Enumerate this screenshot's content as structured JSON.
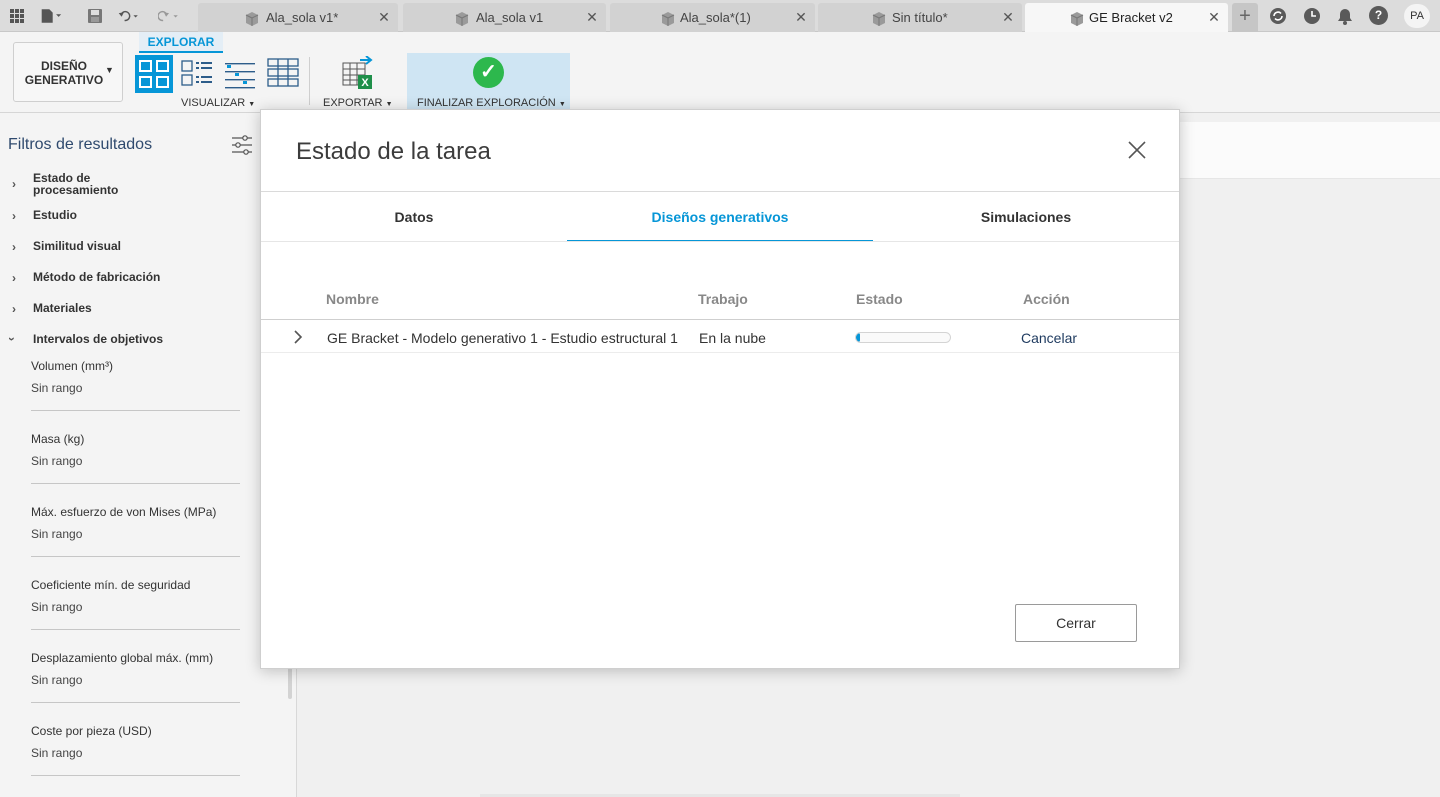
{
  "tabs": [
    {
      "label": "Ala_sola v1*",
      "active": false
    },
    {
      "label": "Ala_sola v1",
      "active": false
    },
    {
      "label": "Ala_sola*(1)",
      "active": false
    },
    {
      "label": "Sin título*",
      "active": false
    },
    {
      "label": "GE Bracket v2",
      "active": true
    }
  ],
  "user_initials": "PA",
  "toolbar": {
    "workspace_label": "DISEÑO GENERATIVO",
    "explore_tab": "EXPLORAR",
    "visualize_label": "VISUALIZAR",
    "export_label": "EXPORTAR",
    "finish_label": "FINALIZAR EXPLORACIÓN"
  },
  "sidebar": {
    "title": "Filtros de resultados",
    "categories": [
      {
        "label": "Estado de procesamiento",
        "expanded": false
      },
      {
        "label": "Estudio",
        "expanded": false
      },
      {
        "label": "Similitud visual",
        "expanded": false
      },
      {
        "label": "Método de fabricación",
        "expanded": false
      },
      {
        "label": "Materiales",
        "expanded": false
      },
      {
        "label": "Intervalos de objetivos",
        "expanded": true
      }
    ],
    "filters": [
      {
        "label": "Volumen (mm³)",
        "value": "Sin rango"
      },
      {
        "label": "Masa (kg)",
        "value": "Sin rango"
      },
      {
        "label": "Máx. esfuerzo de von Mises (MPa)",
        "value": "Sin rango"
      },
      {
        "label": "Coeficiente mín. de seguridad",
        "value": "Sin rango"
      },
      {
        "label": "Desplazamiento global máx. (mm)",
        "value": "Sin rango"
      },
      {
        "label": "Coste por pieza (USD)",
        "value": "Sin rango"
      }
    ]
  },
  "dialog": {
    "title": "Estado de la tarea",
    "tabs": [
      "Datos",
      "Diseños generativos",
      "Simulaciones"
    ],
    "active_tab": 1,
    "columns": [
      "Nombre",
      "Trabajo",
      "Estado",
      "Acción"
    ],
    "rows": [
      {
        "name": "GE Bracket - Modelo generativo 1 - Estudio estructural 1",
        "job": "En la nube",
        "progress": 0.04,
        "action": "Cancelar"
      }
    ],
    "close_label": "Cerrar"
  },
  "colors": {
    "accent": "#0696d7",
    "success": "#2db84d",
    "link": "#1e3a5f"
  }
}
